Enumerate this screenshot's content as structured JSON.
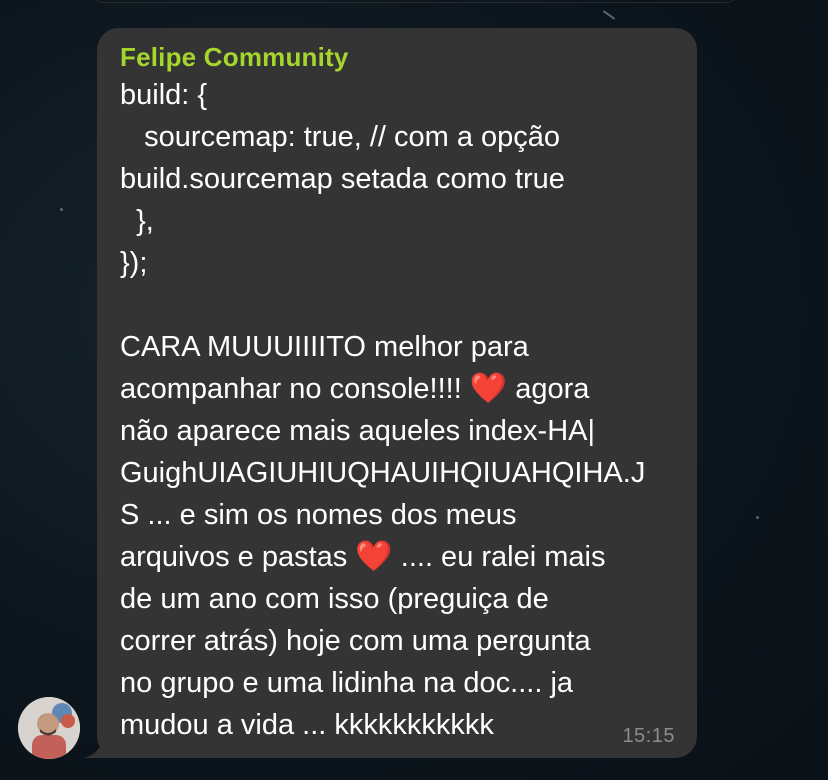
{
  "chat": {
    "sender_name": "Felipe Community",
    "sender_color": "#a5d62b",
    "bubble_color": "#343434",
    "timestamp": "15:15",
    "message_lines": {
      "l1": "build: {",
      "l2": "   sourcemap: true, // com a opção",
      "l3": "build.sourcemap setada como true",
      "l4": "  },",
      "l5": "});",
      "l6": "",
      "l7": "CARA MUUUIIIITO melhor para",
      "l8a": "acompanhar no console!!!! ",
      "l8b": " agora",
      "l9": "não aparece mais aqueles index-HA|",
      "l10": "GuighUIAGIUHIUQHAUIHQIUAHQIHA.J",
      "l11": "S ... e sim os nomes dos meus",
      "l12a": "arquivos e pastas ",
      "l12b": " .... eu ralei mais",
      "l13": "de um ano com isso (preguiça de",
      "l14": "correr atrás) hoje com uma pergunta",
      "l15": "no grupo e uma lidinha na doc.... ja",
      "l16": "mudou a vida ... kkkkkkkkkkk"
    },
    "emoji": {
      "heart": "❤️"
    }
  },
  "avatar": {
    "icon": "user-avatar"
  }
}
